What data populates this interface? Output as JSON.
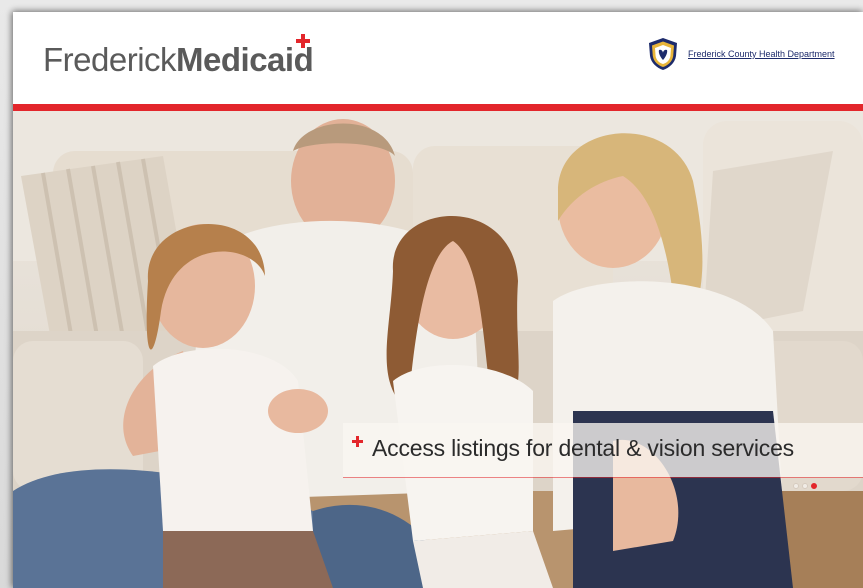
{
  "header": {
    "logo_part1": "Frederick",
    "logo_part2": "Medicaid",
    "department_link": "Frederick County Health Department"
  },
  "hero": {
    "caption": "Access listings for dental & vision services",
    "slides": 3,
    "active_slide": 3
  },
  "colors": {
    "accent_red": "#e3262b",
    "logo_gray": "#5a5a5a",
    "link_navy": "#1d2b6b"
  },
  "icons": [
    "red-cross-icon",
    "county-seal-icon",
    "carousel-dot-icon"
  ]
}
